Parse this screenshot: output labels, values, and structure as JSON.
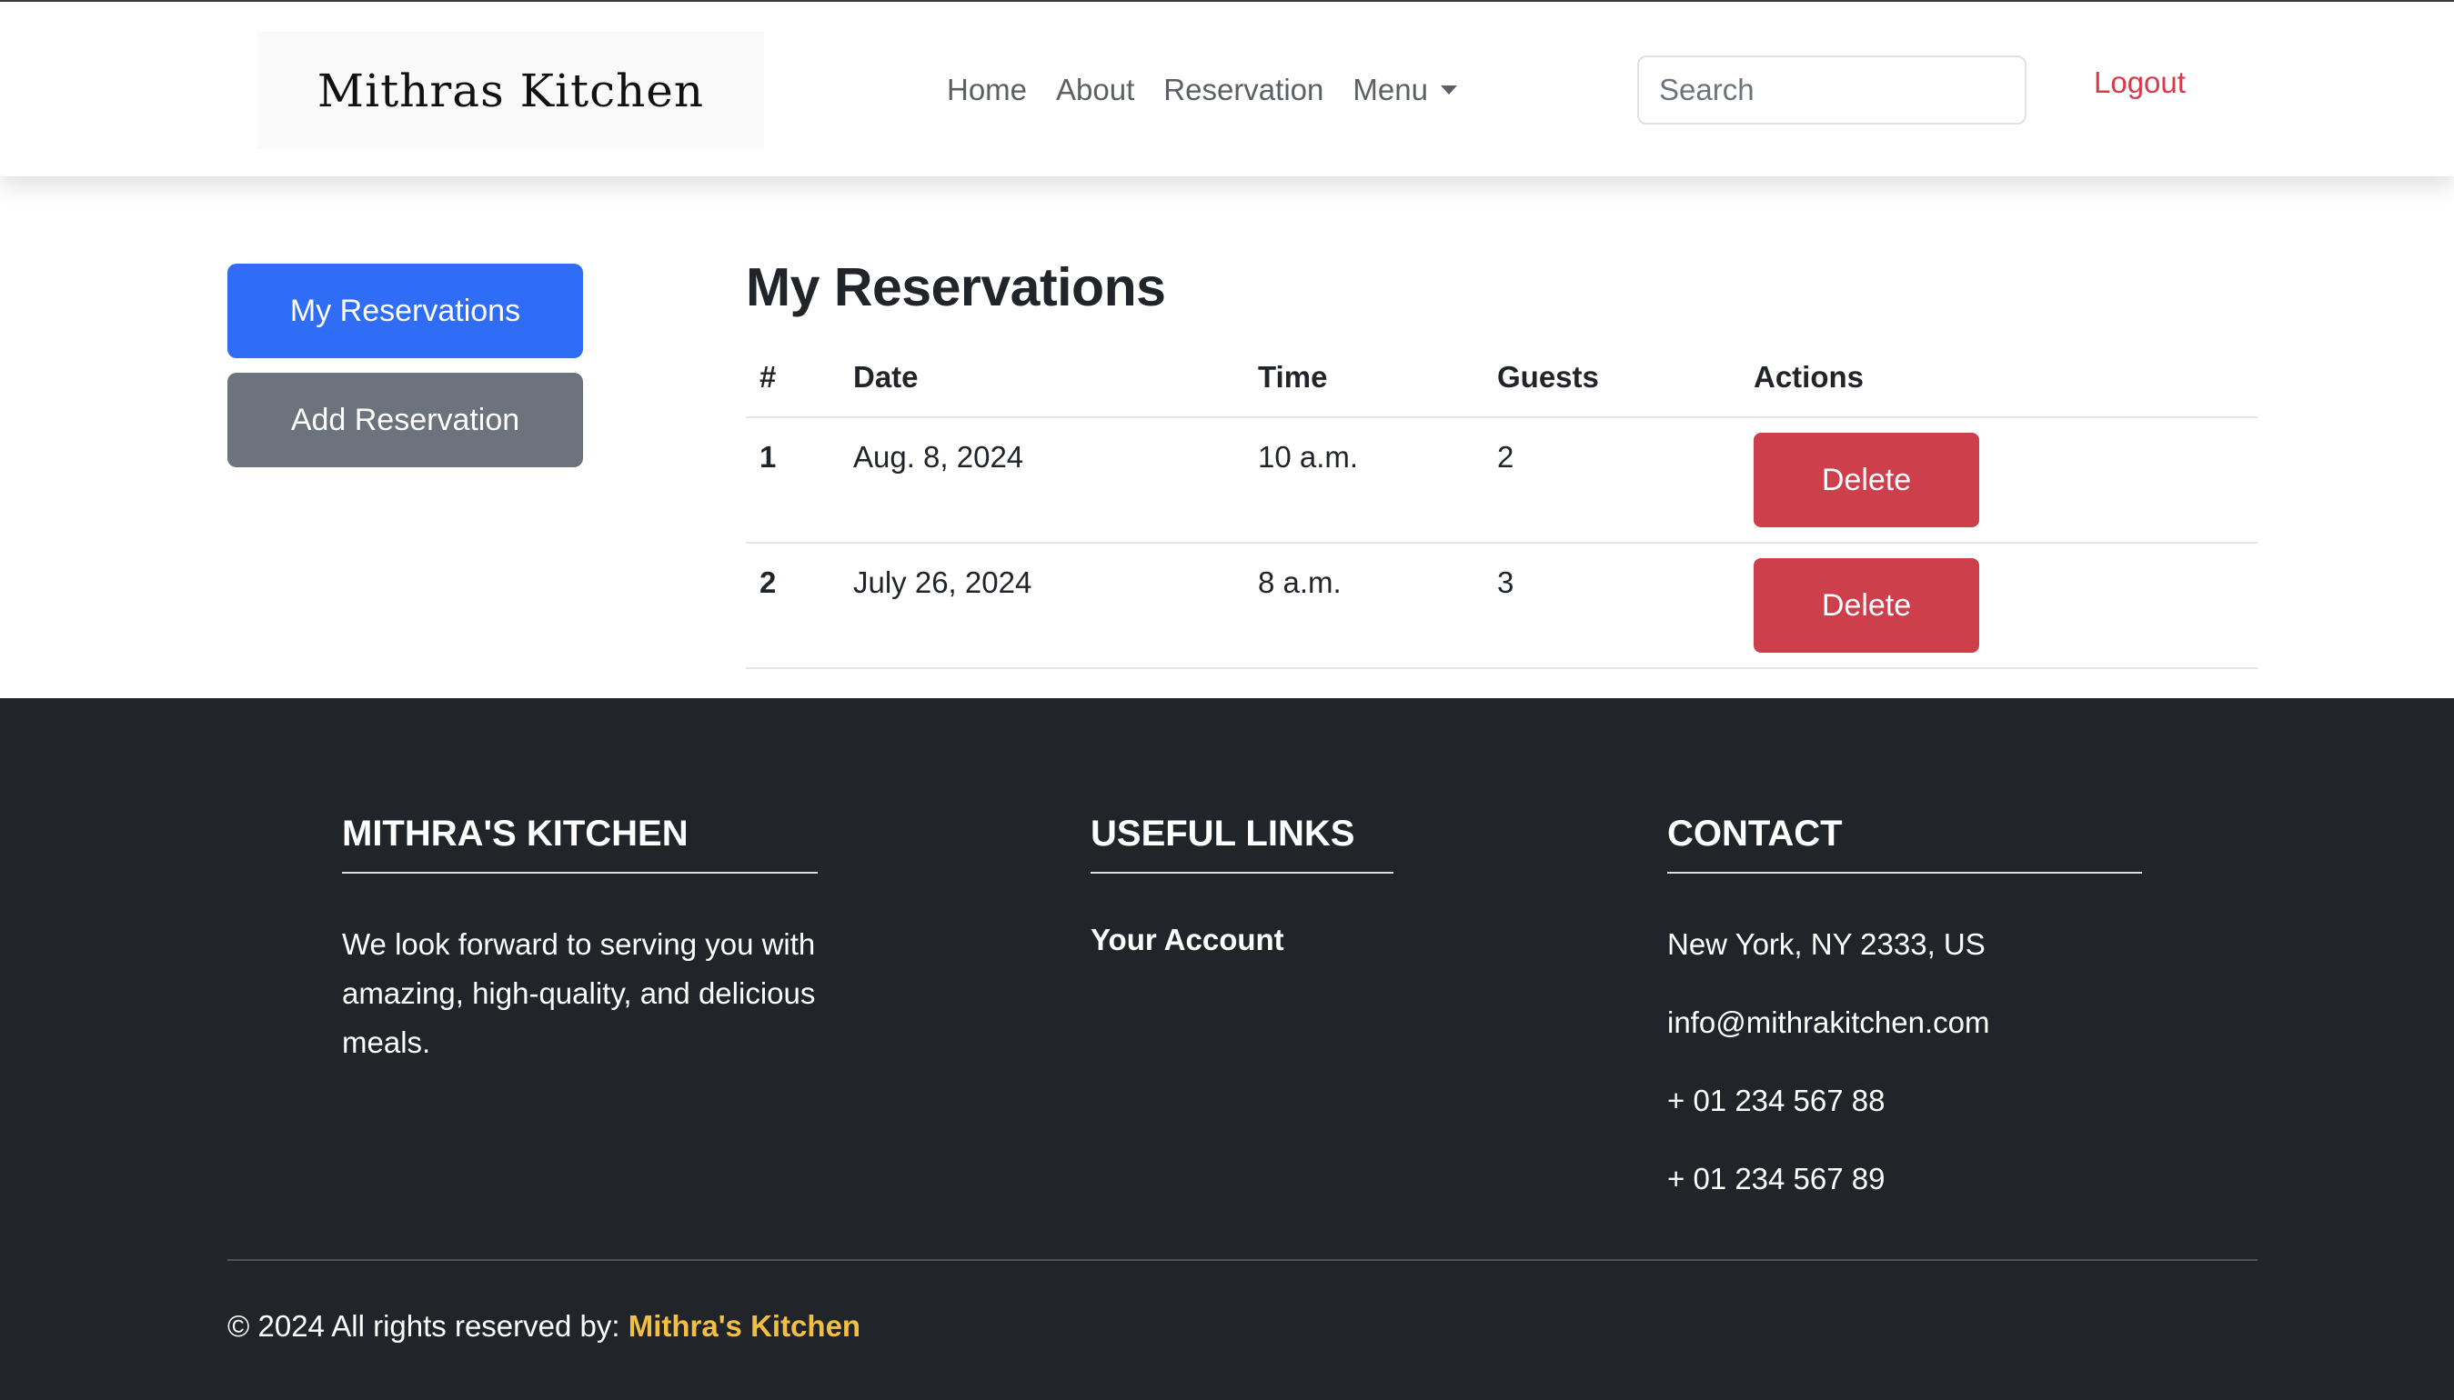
{
  "navbar": {
    "brand": "Mithras Kitchen",
    "links": [
      "Home",
      "About",
      "Reservation",
      "Menu"
    ],
    "search_placeholder": "Search",
    "logout": "Logout"
  },
  "sidebar": {
    "items": [
      {
        "label": "My Reservations",
        "active": true
      },
      {
        "label": "Add Reservation",
        "active": false
      }
    ]
  },
  "main": {
    "title": "My Reservations",
    "columns": [
      "#",
      "Date",
      "Time",
      "Guests",
      "Actions"
    ],
    "rows": [
      {
        "num": "1",
        "date": "Aug. 8, 2024",
        "time": "10 a.m.",
        "guests": "2",
        "action": "Delete"
      },
      {
        "num": "2",
        "date": "July 26, 2024",
        "time": "8 a.m.",
        "guests": "3",
        "action": "Delete"
      }
    ]
  },
  "footer": {
    "about": {
      "heading": "MITHRA'S KITCHEN",
      "lines": [
        "We look forward to serving you with",
        "amazing, high-quality, and delicious",
        "meals."
      ]
    },
    "links": {
      "heading": "USEFUL LINKS",
      "items": [
        "Your Account"
      ]
    },
    "contact": {
      "heading": "CONTACT",
      "address": "New York, NY 2333, US",
      "email": "info@mithrakitchen.com",
      "phone1": "+ 01 234 567 88",
      "phone2": "+ 01 234 567 89"
    },
    "copyright_prefix": "© 2024 All rights reserved by: ",
    "copyright_brand": "Mithra's Kitchen"
  },
  "colors": {
    "primary": "#2f6df6",
    "secondary": "#6c737c",
    "danger": "#cc3f4b",
    "logout": "#d93a4a",
    "footer_bg": "#212529",
    "brand_highlight": "#f2bf42"
  }
}
